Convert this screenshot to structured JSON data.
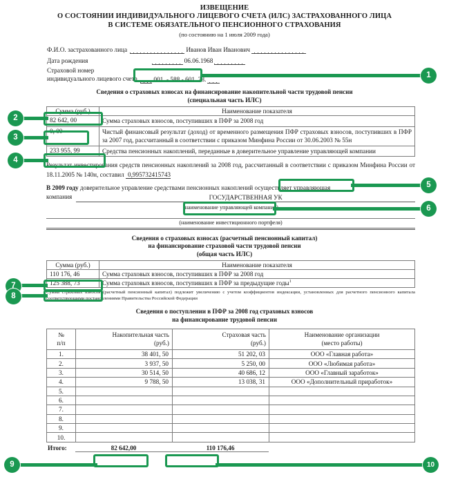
{
  "document": {
    "title_line1": "ИЗВЕЩЕНИЕ",
    "title_line2": "О СОСТОЯНИИ ИНДИВИДУАЛЬНОГО ЛИЦЕВОГО СЧЕТА (ИЛС) ЗАСТРАХОВАННОГО ЛИЦА",
    "title_line3": "В СИСТЕМЕ ОБЯЗАТЕЛЬНОГО ПЕНСИОННОГО СТРАХОВАНИЯ",
    "subtitle": "(по состоянию на 1 июля 2009 года)"
  },
  "person": {
    "fio_label": "Ф.И.О. застрахованного лица",
    "fio_value": "Иванов Иван Иванович",
    "birth_label": "Дата рождения",
    "birth_value": "06.06.1968",
    "snils_label_line1": "Страховой номер",
    "snils_label_line2": "индивидуального лицевого счета",
    "snils_value": "001. - 588 - 601. 28."
  },
  "special_part": {
    "heading_line1": "Сведения о страховых взносах на финансирование накопительной части трудовой пенсии",
    "heading_line2": "(специальная часть ИЛС)",
    "col_sum": "Сумма (руб.)",
    "col_name": "Наименование показателя",
    "rows": [
      {
        "sum": "82 642, 00",
        "name": "Сумма страховых взносов, поступивших в ПФР за 2008 год"
      },
      {
        "sum": "0, 00",
        "name": "Чистый финансовый результат (доход) от временного размещения ПФР страховых взносов, поступивших в ПФР за 2007 год, рассчитанный в соответствии с приказом Минфина России от 30.06.2003 № 55н"
      },
      {
        "sum": "233 955, 99",
        "name": "Средства пенсионных накоплений, переданные в доверительное управление управляющей компании"
      }
    ]
  },
  "investment": {
    "text_before": "Результат инвестирования средств пенсионных накоплений за 2008 год, рассчитанный в соответствии с приказом Минфина России от 18.11.2005 № 140н, составил",
    "value": "0,995732415743"
  },
  "management": {
    "text_bold": "В 2009 году",
    "text_rest": "доверительное управление средствами пенсионных накоплений осуществляет управляющая",
    "company_label": "компания",
    "company_value": "ГОСУДАРСТВЕННАЯ УК",
    "caption_company": "(наименование управляющей компании)",
    "caption_portfolio": "(наименование инвестиционного портфеля)"
  },
  "general_part": {
    "heading_line1": "Сведения о страховых взносах (расчетный пенсионный капитал)",
    "heading_line2": "на финансирование страховой части трудовой пенсии",
    "heading_line3": "(общая часть ИЛС)",
    "col_sum": "Сумма (руб.)",
    "col_name": "Наименование показателя",
    "rows": [
      {
        "sum": "110 176, 46",
        "name": "Сумма страховых взносов, поступивших в ПФР за 2008 год"
      },
      {
        "sum": "125 388, 73",
        "name": "Сумма страховых взносов, поступивших в ПФР за предыдущие годы",
        "footnote_marker": "1"
      }
    ],
    "footnote": "Сумма страховых взносов (расчетный пенсионный капитал) подлежит увеличению с учетом коэффициентов индексации, установленных для расчетного пенсионного капитала соответствующими постановлениями Правительства Российской Федерации"
  },
  "receipts": {
    "heading_line1": "Сведения о поступлении в ПФР за 2008 год страховых взносов",
    "heading_line2": "на финансирование трудовой пенсии",
    "columns": {
      "no_line1": "№",
      "no_line2": "п/п",
      "nakop_line1": "Накопительная часть",
      "nakop_line2": "(руб.)",
      "strah_line1": "Страховая часть",
      "strah_line2": "(руб.)",
      "org_line1": "Наименование организации",
      "org_line2": "(место работы)"
    },
    "rows": [
      {
        "no": "1.",
        "nakop": "38 401, 50",
        "strah": "51 202, 03",
        "org": "ООО «Главная работа»"
      },
      {
        "no": "2.",
        "nakop": "3 937, 50",
        "strah": "5 250, 00",
        "org": "ООО «Любимая работа»"
      },
      {
        "no": "3.",
        "nakop": "30 514, 50",
        "strah": "40 686, 12",
        "org": "ООО «Главный заработок»"
      },
      {
        "no": "4.",
        "nakop": "9 788, 50",
        "strah": "13 038, 31",
        "org": "ООО «Дополнительный приработок»"
      },
      {
        "no": "5.",
        "nakop": "",
        "strah": "",
        "org": ""
      },
      {
        "no": "6.",
        "nakop": "",
        "strah": "",
        "org": ""
      },
      {
        "no": "7.",
        "nakop": "",
        "strah": "",
        "org": ""
      },
      {
        "no": "8.",
        "nakop": "",
        "strah": "",
        "org": ""
      },
      {
        "no": "9.",
        "nakop": "",
        "strah": "",
        "org": ""
      },
      {
        "no": "10.",
        "nakop": "",
        "strah": "",
        "org": ""
      }
    ],
    "total_label": "Итого:",
    "total_nakop": "82 642,00",
    "total_strah": "110 176,46"
  },
  "annotations": {
    "accent_color": "#1a9851",
    "badges": [
      {
        "n": "1",
        "side": "right"
      },
      {
        "n": "2",
        "side": "left"
      },
      {
        "n": "3",
        "side": "left"
      },
      {
        "n": "4",
        "side": "left"
      },
      {
        "n": "5",
        "side": "right"
      },
      {
        "n": "6",
        "side": "right"
      },
      {
        "n": "7",
        "side": "left"
      },
      {
        "n": "8",
        "side": "left"
      },
      {
        "n": "9",
        "side": "left"
      },
      {
        "n": "10",
        "side": "right"
      }
    ]
  }
}
